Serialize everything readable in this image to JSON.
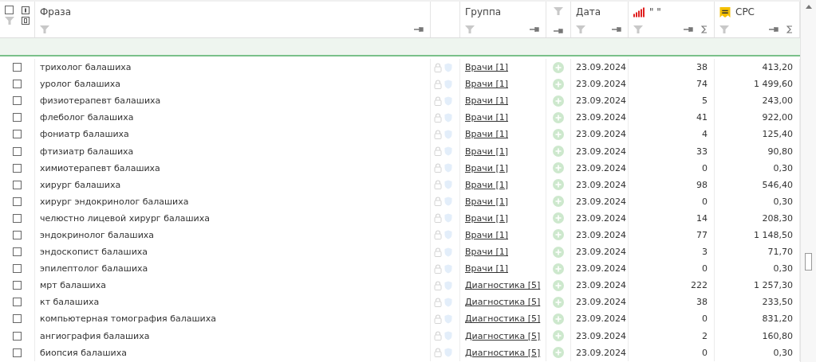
{
  "select_all": {
    "checked": false
  },
  "columns": {
    "phrase": "Фраза",
    "group": "Группа",
    "date": "Дата",
    "count": "\" \"",
    "cpc": "CPC"
  },
  "rows": [
    {
      "checked": false,
      "phrase": "трихолог балашиха",
      "group": "Врачи [1]",
      "date": "23.09.2024",
      "count": "38",
      "cpc": "413,20"
    },
    {
      "checked": false,
      "phrase": "уролог балашиха",
      "group": "Врачи [1]",
      "date": "23.09.2024",
      "count": "74",
      "cpc": "1 499,60"
    },
    {
      "checked": false,
      "phrase": "физиотерапевт балашиха",
      "group": "Врачи [1]",
      "date": "23.09.2024",
      "count": "5",
      "cpc": "243,00"
    },
    {
      "checked": false,
      "phrase": "флеболог балашиха",
      "group": "Врачи [1]",
      "date": "23.09.2024",
      "count": "41",
      "cpc": "922,00"
    },
    {
      "checked": false,
      "phrase": "фониатр балашиха",
      "group": "Врачи [1]",
      "date": "23.09.2024",
      "count": "4",
      "cpc": "125,40"
    },
    {
      "checked": false,
      "phrase": "фтизиатр балашиха",
      "group": "Врачи [1]",
      "date": "23.09.2024",
      "count": "33",
      "cpc": "90,80"
    },
    {
      "checked": false,
      "phrase": "химиотерапевт балашиха",
      "group": "Врачи [1]",
      "date": "23.09.2024",
      "count": "0",
      "cpc": "0,30"
    },
    {
      "checked": false,
      "phrase": "хирург балашиха",
      "group": "Врачи [1]",
      "date": "23.09.2024",
      "count": "98",
      "cpc": "546,40"
    },
    {
      "checked": false,
      "phrase": "хирург эндокринолог балашиха",
      "group": "Врачи [1]",
      "date": "23.09.2024",
      "count": "0",
      "cpc": "0,30"
    },
    {
      "checked": false,
      "phrase": "челюстно лицевой хирург балашиха",
      "group": "Врачи [1]",
      "date": "23.09.2024",
      "count": "14",
      "cpc": "208,30"
    },
    {
      "checked": false,
      "phrase": "эндокринолог балашиха",
      "group": "Врачи [1]",
      "date": "23.09.2024",
      "count": "77",
      "cpc": "1 148,50"
    },
    {
      "checked": false,
      "phrase": "эндоскопист балашиха",
      "group": "Врачи [1]",
      "date": "23.09.2024",
      "count": "3",
      "cpc": "71,70"
    },
    {
      "checked": false,
      "phrase": "эпилептолог балашиха",
      "group": "Врачи [1]",
      "date": "23.09.2024",
      "count": "0",
      "cpc": "0,30"
    },
    {
      "checked": false,
      "phrase": "мрт балашиха",
      "group": "Диагностика [5]",
      "date": "23.09.2024",
      "count": "222",
      "cpc": "1 257,30"
    },
    {
      "checked": false,
      "phrase": "кт балашиха",
      "group": "Диагностика [5]",
      "date": "23.09.2024",
      "count": "38",
      "cpc": "233,50"
    },
    {
      "checked": false,
      "phrase": "компьютерная томография балашиха",
      "group": "Диагностика [5]",
      "date": "23.09.2024",
      "count": "0",
      "cpc": "831,20"
    },
    {
      "checked": false,
      "phrase": "ангиография балашиха",
      "group": "Диагностика [5]",
      "date": "23.09.2024",
      "count": "2",
      "cpc": "160,80"
    },
    {
      "checked": false,
      "phrase": "биопсия балашиха",
      "group": "Диагностика [5]",
      "date": "23.09.2024",
      "count": "0",
      "cpc": "0,30"
    }
  ]
}
